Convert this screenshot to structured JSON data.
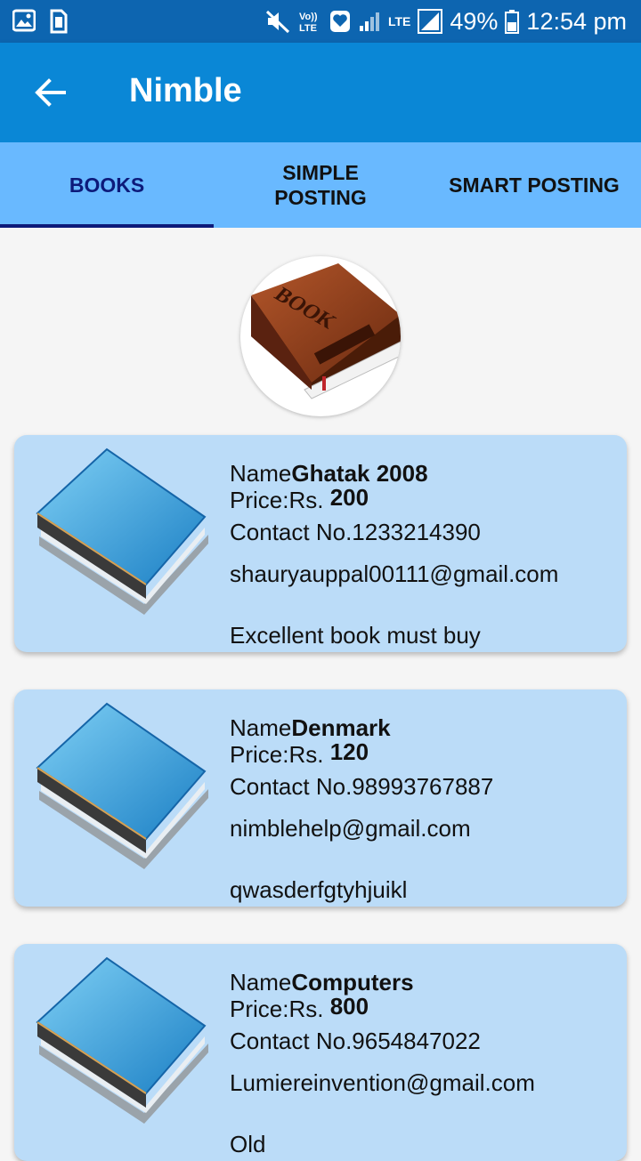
{
  "status_bar": {
    "battery": "49%",
    "time": "12:54 pm",
    "network_label": "LTE"
  },
  "app_bar": {
    "title": "Nimble"
  },
  "tabs": [
    {
      "label": "BOOKS",
      "active": true
    },
    {
      "label": "SIMPLE POSTING",
      "active": false
    },
    {
      "label": "SMART POSTING",
      "active": false
    }
  ],
  "header_logo": {
    "text": "BOOK"
  },
  "books": [
    {
      "name_prefix": "Name",
      "name": "Ghatak 2008",
      "price_prefix": "Price:Rs.",
      "price": "200",
      "contact_prefix": "Contact No.",
      "contact": "1233214390",
      "email": "shauryauppal00111@gmail.com",
      "description": "Excellent book must buy"
    },
    {
      "name_prefix": "Name",
      "name": "Denmark",
      "price_prefix": "Price:Rs.",
      "price": "120",
      "contact_prefix": "Contact No.",
      "contact": "98993767887",
      "email": "nimblehelp@gmail.com",
      "description": "qwasderfgtyhjuikl"
    },
    {
      "name_prefix": "Name",
      "name": "Computers",
      "price_prefix": "Price:Rs.",
      "price": "800",
      "contact_prefix": "Contact No.",
      "contact": "9654847022",
      "email": "Lumiereinvention@gmail.com",
      "description": "Old"
    }
  ],
  "colors": {
    "status_bar": "#0d65b0",
    "app_bar": "#0a87d6",
    "tab_bar": "#69b9ff",
    "tab_active": "#0d1a7a",
    "card": "#bbdcf8"
  }
}
